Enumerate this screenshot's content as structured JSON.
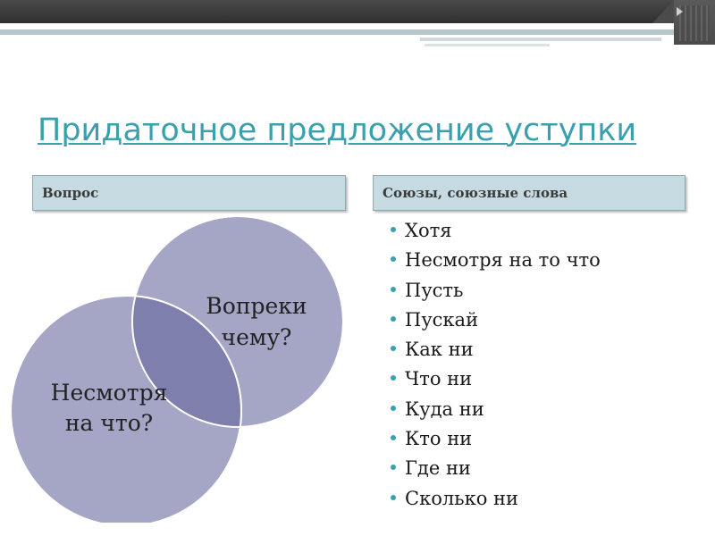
{
  "slide": {
    "title": "Придаточное предложение уступки"
  },
  "headers": {
    "left": "Вопрос",
    "right": "Союзы, союзные слова"
  },
  "venn": {
    "circle_top": [
      "Вопреки",
      "чему?"
    ],
    "circle_bottom": [
      "Несмотря",
      "на что?"
    ],
    "colors": {
      "circle_top": "#a5a5c6",
      "circle_bottom": "#a5a5c6",
      "overlap": "#7f7fae",
      "stroke": "#ffffff"
    }
  },
  "conjunctions": [
    "Хотя",
    "Несмотря на то что",
    "Пусть",
    "Пускай",
    "Как ни",
    "Что ни",
    "Куда ни",
    "Кто ни",
    "Где ни",
    "Сколько ни"
  ],
  "theme": {
    "title_color": "#3aa0ad",
    "header_fill": "#c6dbe1",
    "bullet_color": "#3aa0ad"
  }
}
